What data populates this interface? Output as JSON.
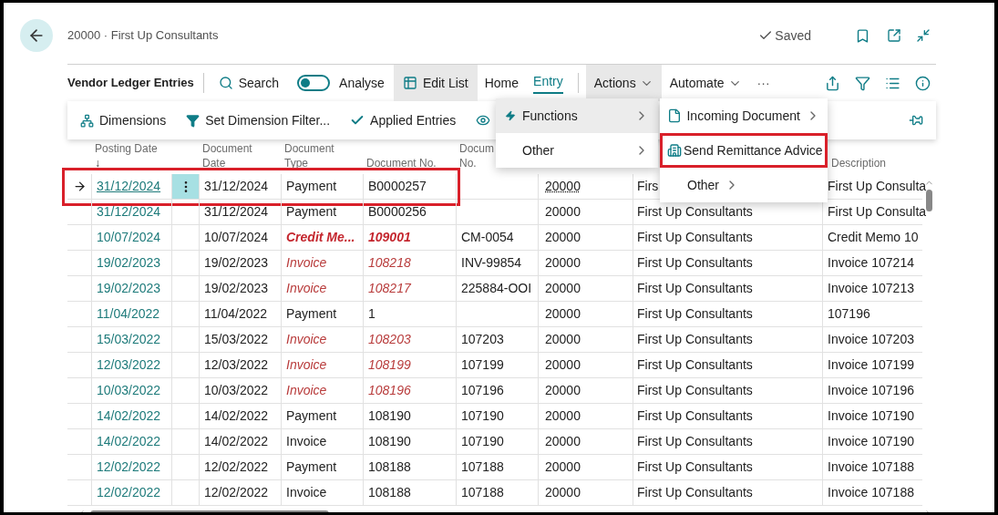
{
  "page": {
    "title": "20000 · First Up Consultants",
    "status": "Saved"
  },
  "action_bar": {
    "title": "Vendor Ledger Entries",
    "search": "Search",
    "analyse": {
      "label": "Analyse",
      "on": false
    },
    "edit_list": "Edit List",
    "tabs": [
      {
        "label": "Home",
        "selected": false
      },
      {
        "label": "Entry",
        "selected": true
      }
    ],
    "menus": [
      {
        "label": "Actions",
        "expanded": true
      },
      {
        "label": "Automate",
        "expanded": false
      }
    ],
    "more": "···"
  },
  "promoted": [
    {
      "kind": "dimensions",
      "label": "Dimensions"
    },
    {
      "kind": "filter",
      "label": "Set Dimension Filter..."
    },
    {
      "kind": "check",
      "label": "Applied Entries"
    },
    {
      "kind": "eye"
    }
  ],
  "dropdown": [
    {
      "kind": "bolt",
      "label": "Functions",
      "selected": true
    },
    {
      "kind": "plain",
      "label": "Other",
      "selected": false
    }
  ],
  "submenu": [
    {
      "kind": "file",
      "label": "Incoming Document",
      "has_submenu": true,
      "highlighted": false
    },
    {
      "kind": "remittance",
      "label": "Send Remittance Advice",
      "has_submenu": false,
      "highlighted": true
    },
    {
      "kind": "plain",
      "label": "Other",
      "has_submenu": true,
      "highlighted": false
    }
  ],
  "table": {
    "columns": [
      {
        "lines": [
          "Posting Date"
        ],
        "sort": "↓"
      },
      {
        "lines": [
          "Document",
          "Date"
        ]
      },
      {
        "lines": [
          "Document",
          "Type"
        ]
      },
      {
        "lines": [
          "Document No."
        ]
      },
      {
        "lines": [
          "Docum",
          "No."
        ]
      },
      {
        "lines": [
          "Description"
        ]
      }
    ],
    "rows": [
      {
        "posting_date": "31/12/2024",
        "document_date": "31/12/2024",
        "document_type": "Payment",
        "document_no": "B0000257",
        "vendor_no": "20000",
        "name": "Firs",
        "description": "First Up Consulta",
        "bold": false,
        "italic": false,
        "selected": true,
        "highlighted": true
      },
      {
        "posting_date": "31/12/2024",
        "document_date": "31/12/2024",
        "document_type": "Payment",
        "document_no": "B0000256",
        "vendor_no": "20000",
        "name": "First Up Consultants",
        "description": "First Up Consulta",
        "bold": false,
        "italic": false,
        "selected": false,
        "highlighted": false
      },
      {
        "posting_date": "10/07/2024",
        "document_date": "10/07/2024",
        "document_type": "Credit Me...",
        "document_no": "109001",
        "external_document_no": "CM-0054",
        "vendor_no": "20000",
        "name": "First Up Consultants",
        "description": "Credit Memo 10",
        "bold": true,
        "italic": true,
        "selected": false,
        "highlighted": false
      },
      {
        "posting_date": "19/02/2023",
        "document_date": "19/02/2023",
        "document_type": "Invoice",
        "document_no": "108218",
        "external_document_no": "INV-99854",
        "vendor_no": "20000",
        "name": "First Up Consultants",
        "description": "Invoice 107214",
        "bold": false,
        "italic": true,
        "selected": false,
        "highlighted": false
      },
      {
        "posting_date": "19/02/2023",
        "document_date": "19/02/2023",
        "document_type": "Invoice",
        "document_no": "108217",
        "external_document_no": "225884-OOI",
        "vendor_no": "20000",
        "name": "First Up Consultants",
        "description": "Invoice 107213",
        "bold": false,
        "italic": true,
        "selected": false,
        "highlighted": false
      },
      {
        "posting_date": "11/04/2022",
        "document_date": "11/04/2022",
        "document_type": "Payment",
        "document_no": "1",
        "vendor_no": "20000",
        "name": "First Up Consultants",
        "description": "107196",
        "bold": false,
        "italic": false,
        "selected": false,
        "highlighted": false
      },
      {
        "posting_date": "15/03/2022",
        "document_date": "15/03/2022",
        "document_type": "Invoice",
        "document_no": "108203",
        "external_document_no": "107203",
        "vendor_no": "20000",
        "name": "First Up Consultants",
        "description": "Invoice 107203",
        "bold": false,
        "italic": true,
        "selected": false,
        "highlighted": false
      },
      {
        "posting_date": "12/03/2022",
        "document_date": "12/03/2022",
        "document_type": "Invoice",
        "document_no": "108199",
        "external_document_no": "107199",
        "vendor_no": "20000",
        "name": "First Up Consultants",
        "description": "Invoice 107199",
        "bold": false,
        "italic": true,
        "selected": false,
        "highlighted": false
      },
      {
        "posting_date": "10/03/2022",
        "document_date": "10/03/2022",
        "document_type": "Invoice",
        "document_no": "108196",
        "external_document_no": "107196",
        "vendor_no": "20000",
        "name": "First Up Consultants",
        "description": "Invoice 107196",
        "bold": false,
        "italic": true,
        "selected": false,
        "highlighted": false
      },
      {
        "posting_date": "14/02/2022",
        "document_date": "14/02/2022",
        "document_type": "Payment",
        "document_no": "108190",
        "external_document_no": "107190",
        "vendor_no": "20000",
        "name": "First Up Consultants",
        "description": "Invoice 107190",
        "bold": false,
        "italic": false,
        "selected": false,
        "highlighted": false
      },
      {
        "posting_date": "14/02/2022",
        "document_date": "14/02/2022",
        "document_type": "Invoice",
        "document_no": "108190",
        "external_document_no": "107190",
        "vendor_no": "20000",
        "name": "First Up Consultants",
        "description": "Invoice 107190",
        "bold": false,
        "italic": false,
        "selected": false,
        "highlighted": false
      },
      {
        "posting_date": "12/02/2022",
        "document_date": "12/02/2022",
        "document_type": "Payment",
        "document_no": "108188",
        "external_document_no": "107188",
        "vendor_no": "20000",
        "name": "First Up Consultants",
        "description": "Invoice 107188",
        "bold": false,
        "italic": false,
        "selected": false,
        "highlighted": false
      },
      {
        "posting_date": "12/02/2022",
        "document_date": "12/02/2022",
        "document_type": "Invoice",
        "document_no": "108188",
        "external_document_no": "107188",
        "vendor_no": "20000",
        "name": "First Up Consultants",
        "description": "Invoice 107188",
        "bold": false,
        "italic": false,
        "selected": false,
        "highlighted": false
      }
    ]
  }
}
